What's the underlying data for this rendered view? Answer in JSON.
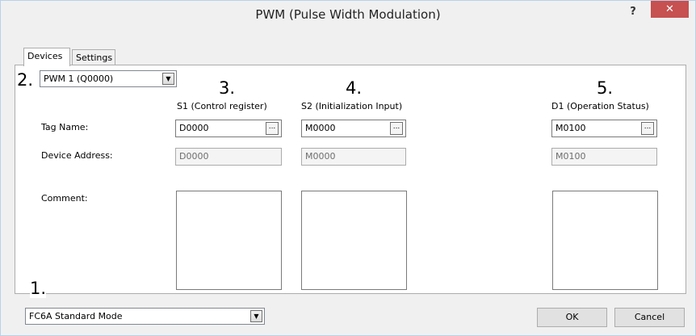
{
  "window": {
    "title": "PWM (Pulse Width Modulation)",
    "help_label": "?",
    "close_label": "✕"
  },
  "tabs": [
    {
      "label": "Devices"
    },
    {
      "label": "Settings"
    }
  ],
  "markers": {
    "m1": "1.",
    "m2": "2.",
    "m3": "3.",
    "m4": "4.",
    "m5": "5."
  },
  "pwm_select": {
    "value": "PWM 1 (Q0000)",
    "arrow": "▼"
  },
  "columns": [
    {
      "header": "S1 (Control register)",
      "tag_name": "D0000",
      "device_address": "D0000"
    },
    {
      "header": "S2 (Initialization Input)",
      "tag_name": "M0000",
      "device_address": "M0000"
    },
    {
      "header": "D1 (Operation Status)",
      "tag_name": "M0100",
      "device_address": "M0100"
    }
  ],
  "row_labels": {
    "tag_name": "Tag Name:",
    "device_address": "Device Address:",
    "comment": "Comment:"
  },
  "browse_label": "...",
  "mode_select": {
    "value": "FC6A Standard Mode",
    "arrow": "▼"
  },
  "buttons": {
    "ok": "OK",
    "cancel": "Cancel"
  }
}
